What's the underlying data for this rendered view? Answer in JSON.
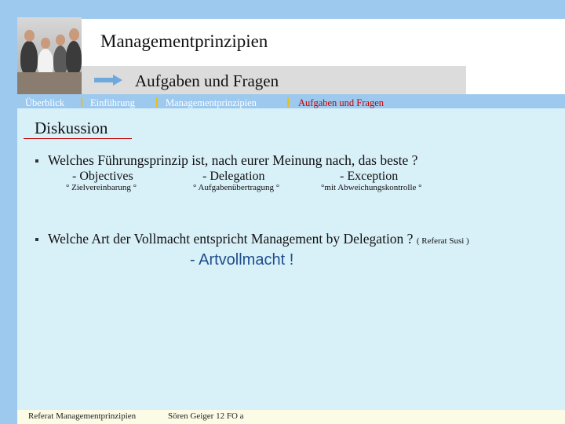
{
  "header": {
    "title": "Managementprinzipien",
    "subtitle": "Aufgaben und Fragen"
  },
  "nav": {
    "items": [
      {
        "label": "Überblick",
        "active": false
      },
      {
        "label": "Einführung",
        "active": false
      },
      {
        "label": "Managementprinzipien",
        "active": false
      },
      {
        "label": "Aufgaben und Fragen",
        "active": true
      }
    ]
  },
  "content": {
    "heading": "Diskussion",
    "question1": "Welches Führungsprinzip ist, nach eurer Meinung nach, das beste ?",
    "options": [
      {
        "label": "- Objectives",
        "sub": "° Zielvereinbarung °"
      },
      {
        "label": "- Delegation",
        "sub": "° Aufgabenübertragung °"
      },
      {
        "label": "- Exception",
        "sub": "°mit Abweichungskontrolle °"
      }
    ],
    "question2": "Welche Art der Vollmacht entspricht Management by Delegation ? ",
    "question2_ref": "( Referat Susi )",
    "answer": "- Artvollmacht !"
  },
  "footer": {
    "left": "Referat Managementprinzipien",
    "right": "Sören Geiger  12 FO a"
  },
  "colors": {
    "accent_blue": "#9ec9ee",
    "content_bg": "#d8f0f8",
    "active_nav": "#c00000",
    "answer": "#1f4e8c"
  }
}
